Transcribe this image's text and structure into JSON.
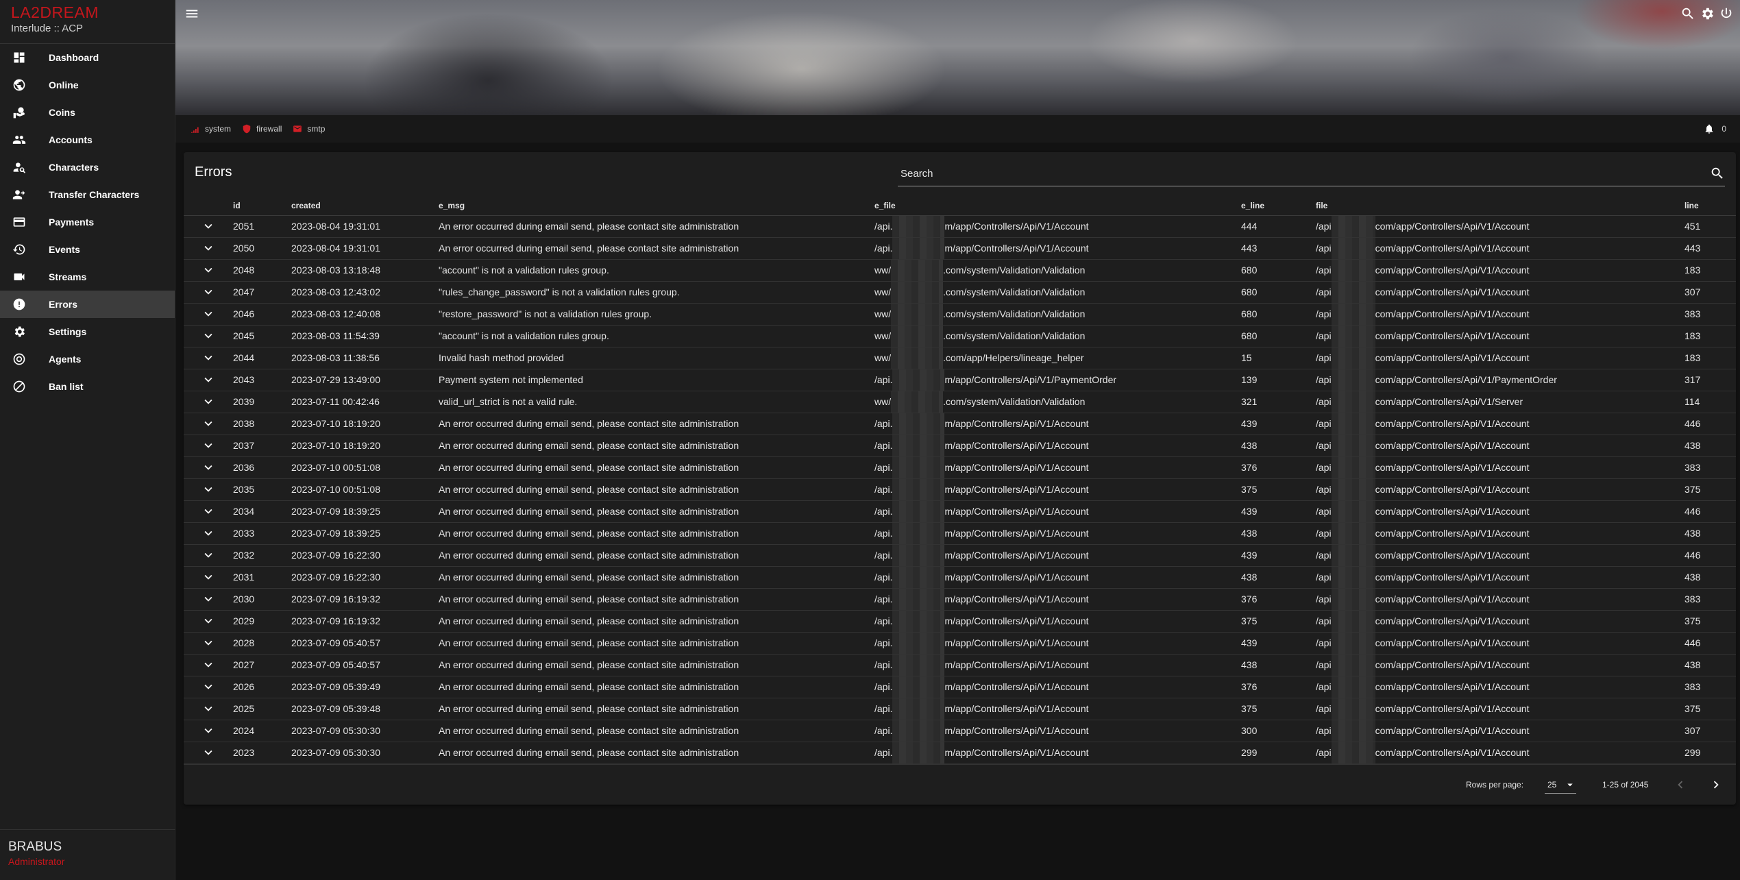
{
  "brand": {
    "logo": "LA2DREAM",
    "subtitle": "Interlude :: ACP"
  },
  "nav": [
    {
      "label": "Dashboard",
      "icon": "dashboard-icon"
    },
    {
      "label": "Online",
      "icon": "globe-icon"
    },
    {
      "label": "Coins",
      "icon": "coins-icon"
    },
    {
      "label": "Accounts",
      "icon": "people-icon"
    },
    {
      "label": "Characters",
      "icon": "person-search-icon"
    },
    {
      "label": "Transfer Characters",
      "icon": "person-transfer-icon"
    },
    {
      "label": "Payments",
      "icon": "credit-card-icon"
    },
    {
      "label": "Events",
      "icon": "history-icon"
    },
    {
      "label": "Streams",
      "icon": "videocam-icon"
    },
    {
      "label": "Errors",
      "icon": "error-icon",
      "active": true
    },
    {
      "label": "Settings",
      "icon": "gear-icon"
    },
    {
      "label": "Agents",
      "icon": "agent-icon"
    },
    {
      "label": "Ban list",
      "icon": "block-icon"
    }
  ],
  "user": {
    "name": "BRABUS",
    "role": "Administrator"
  },
  "status": {
    "items": [
      "system",
      "firewall",
      "smtp"
    ],
    "notifications": "0"
  },
  "accent_color": "#c4161c",
  "errors": {
    "title": "Errors",
    "search_placeholder": "Search",
    "columns": [
      "id",
      "created",
      "e_msg",
      "e_file",
      "e_line",
      "file",
      "line"
    ],
    "rows": [
      {
        "id": "2051",
        "created": "2023-08-04 19:31:01",
        "msg": "An error occurred during email send, please contact site administration",
        "efile_pre": "/api.",
        "efile_post": "m/app/Controllers/Api/V1/Account",
        "eline": "444",
        "file_pre": "/api",
        "file_post": "com/app/Controllers/Api/V1/Account",
        "line": "451"
      },
      {
        "id": "2050",
        "created": "2023-08-04 19:31:01",
        "msg": "An error occurred during email send, please contact site administration",
        "efile_pre": "/api.",
        "efile_post": "m/app/Controllers/Api/V1/Account",
        "eline": "443",
        "file_pre": "/api",
        "file_post": "com/app/Controllers/Api/V1/Account",
        "line": "443"
      },
      {
        "id": "2048",
        "created": "2023-08-03 13:18:48",
        "msg": "\"account\" is not a validation rules group.",
        "efile_pre": "ww/",
        "efile_post": ".com/system/Validation/Validation",
        "eline": "680",
        "file_pre": "/api",
        "file_post": "com/app/Controllers/Api/V1/Account",
        "line": "183"
      },
      {
        "id": "2047",
        "created": "2023-08-03 12:43:02",
        "msg": "\"rules_change_password\" is not a validation rules group.",
        "efile_pre": "ww/",
        "efile_post": ".com/system/Validation/Validation",
        "eline": "680",
        "file_pre": "/api",
        "file_post": "com/app/Controllers/Api/V1/Account",
        "line": "307"
      },
      {
        "id": "2046",
        "created": "2023-08-03 12:40:08",
        "msg": "\"restore_password\" is not a validation rules group.",
        "efile_pre": "ww/",
        "efile_post": ".com/system/Validation/Validation",
        "eline": "680",
        "file_pre": "/api",
        "file_post": "com/app/Controllers/Api/V1/Account",
        "line": "383"
      },
      {
        "id": "2045",
        "created": "2023-08-03 11:54:39",
        "msg": "\"account\" is not a validation rules group.",
        "efile_pre": "ww/",
        "efile_post": ".com/system/Validation/Validation",
        "eline": "680",
        "file_pre": "/api",
        "file_post": "com/app/Controllers/Api/V1/Account",
        "line": "183"
      },
      {
        "id": "2044",
        "created": "2023-08-03 11:38:56",
        "msg": "Invalid hash method provided",
        "efile_pre": "ww/",
        "efile_post": ".com/app/Helpers/lineage_helper",
        "eline": "15",
        "file_pre": "/api",
        "file_post": "com/app/Controllers/Api/V1/Account",
        "line": "183"
      },
      {
        "id": "2043",
        "created": "2023-07-29 13:49:00",
        "msg": "Payment system not implemented",
        "efile_pre": "/api.",
        "efile_post": "m/app/Controllers/Api/V1/PaymentOrder",
        "eline": "139",
        "file_pre": "/api",
        "file_post": "com/app/Controllers/Api/V1/PaymentOrder",
        "line": "317"
      },
      {
        "id": "2039",
        "created": "2023-07-11 00:42:46",
        "msg": "valid_url_strict is not a valid rule.",
        "efile_pre": "ww/",
        "efile_post": ".com/system/Validation/Validation",
        "eline": "321",
        "file_pre": "/api",
        "file_post": "com/app/Controllers/Api/V1/Server",
        "line": "114"
      },
      {
        "id": "2038",
        "created": "2023-07-10 18:19:20",
        "msg": "An error occurred during email send, please contact site administration",
        "efile_pre": "/api.",
        "efile_post": "m/app/Controllers/Api/V1/Account",
        "eline": "439",
        "file_pre": "/api",
        "file_post": "com/app/Controllers/Api/V1/Account",
        "line": "446"
      },
      {
        "id": "2037",
        "created": "2023-07-10 18:19:20",
        "msg": "An error occurred during email send, please contact site administration",
        "efile_pre": "/api.",
        "efile_post": "m/app/Controllers/Api/V1/Account",
        "eline": "438",
        "file_pre": "/api",
        "file_post": "com/app/Controllers/Api/V1/Account",
        "line": "438"
      },
      {
        "id": "2036",
        "created": "2023-07-10 00:51:08",
        "msg": "An error occurred during email send, please contact site administration",
        "efile_pre": "/api.",
        "efile_post": "m/app/Controllers/Api/V1/Account",
        "eline": "376",
        "file_pre": "/api",
        "file_post": "com/app/Controllers/Api/V1/Account",
        "line": "383"
      },
      {
        "id": "2035",
        "created": "2023-07-10 00:51:08",
        "msg": "An error occurred during email send, please contact site administration",
        "efile_pre": "/api.",
        "efile_post": "m/app/Controllers/Api/V1/Account",
        "eline": "375",
        "file_pre": "/api",
        "file_post": "com/app/Controllers/Api/V1/Account",
        "line": "375"
      },
      {
        "id": "2034",
        "created": "2023-07-09 18:39:25",
        "msg": "An error occurred during email send, please contact site administration",
        "efile_pre": "/api.",
        "efile_post": "m/app/Controllers/Api/V1/Account",
        "eline": "439",
        "file_pre": "/api",
        "file_post": "com/app/Controllers/Api/V1/Account",
        "line": "446"
      },
      {
        "id": "2033",
        "created": "2023-07-09 18:39:25",
        "msg": "An error occurred during email send, please contact site administration",
        "efile_pre": "/api.",
        "efile_post": "m/app/Controllers/Api/V1/Account",
        "eline": "438",
        "file_pre": "/api",
        "file_post": "com/app/Controllers/Api/V1/Account",
        "line": "438"
      },
      {
        "id": "2032",
        "created": "2023-07-09 16:22:30",
        "msg": "An error occurred during email send, please contact site administration",
        "efile_pre": "/api.",
        "efile_post": "m/app/Controllers/Api/V1/Account",
        "eline": "439",
        "file_pre": "/api",
        "file_post": "com/app/Controllers/Api/V1/Account",
        "line": "446"
      },
      {
        "id": "2031",
        "created": "2023-07-09 16:22:30",
        "msg": "An error occurred during email send, please contact site administration",
        "efile_pre": "/api.",
        "efile_post": "m/app/Controllers/Api/V1/Account",
        "eline": "438",
        "file_pre": "/api",
        "file_post": "com/app/Controllers/Api/V1/Account",
        "line": "438"
      },
      {
        "id": "2030",
        "created": "2023-07-09 16:19:32",
        "msg": "An error occurred during email send, please contact site administration",
        "efile_pre": "/api.",
        "efile_post": "m/app/Controllers/Api/V1/Account",
        "eline": "376",
        "file_pre": "/api",
        "file_post": "com/app/Controllers/Api/V1/Account",
        "line": "383"
      },
      {
        "id": "2029",
        "created": "2023-07-09 16:19:32",
        "msg": "An error occurred during email send, please contact site administration",
        "efile_pre": "/api.",
        "efile_post": "m/app/Controllers/Api/V1/Account",
        "eline": "375",
        "file_pre": "/api",
        "file_post": "com/app/Controllers/Api/V1/Account",
        "line": "375"
      },
      {
        "id": "2028",
        "created": "2023-07-09 05:40:57",
        "msg": "An error occurred during email send, please contact site administration",
        "efile_pre": "/api.",
        "efile_post": "m/app/Controllers/Api/V1/Account",
        "eline": "439",
        "file_pre": "/api",
        "file_post": "com/app/Controllers/Api/V1/Account",
        "line": "446"
      },
      {
        "id": "2027",
        "created": "2023-07-09 05:40:57",
        "msg": "An error occurred during email send, please contact site administration",
        "efile_pre": "/api.",
        "efile_post": "m/app/Controllers/Api/V1/Account",
        "eline": "438",
        "file_pre": "/api",
        "file_post": "com/app/Controllers/Api/V1/Account",
        "line": "438"
      },
      {
        "id": "2026",
        "created": "2023-07-09 05:39:49",
        "msg": "An error occurred during email send, please contact site administration",
        "efile_pre": "/api.",
        "efile_post": "m/app/Controllers/Api/V1/Account",
        "eline": "376",
        "file_pre": "/api",
        "file_post": "com/app/Controllers/Api/V1/Account",
        "line": "383"
      },
      {
        "id": "2025",
        "created": "2023-07-09 05:39:48",
        "msg": "An error occurred during email send, please contact site administration",
        "efile_pre": "/api.",
        "efile_post": "m/app/Controllers/Api/V1/Account",
        "eline": "375",
        "file_pre": "/api",
        "file_post": "com/app/Controllers/Api/V1/Account",
        "line": "375"
      },
      {
        "id": "2024",
        "created": "2023-07-09 05:30:30",
        "msg": "An error occurred during email send, please contact site administration",
        "efile_pre": "/api.",
        "efile_post": "m/app/Controllers/Api/V1/Account",
        "eline": "300",
        "file_pre": "/api",
        "file_post": "com/app/Controllers/Api/V1/Account",
        "line": "307"
      },
      {
        "id": "2023",
        "created": "2023-07-09 05:30:30",
        "msg": "An error occurred during email send, please contact site administration",
        "efile_pre": "/api.",
        "efile_post": "m/app/Controllers/Api/V1/Account",
        "eline": "299",
        "file_pre": "/api",
        "file_post": "com/app/Controllers/Api/V1/Account",
        "line": "299"
      }
    ],
    "pagination": {
      "rows_per_page_label": "Rows per page:",
      "rows_per_page": "25",
      "range": "1-25 of 2045"
    }
  }
}
